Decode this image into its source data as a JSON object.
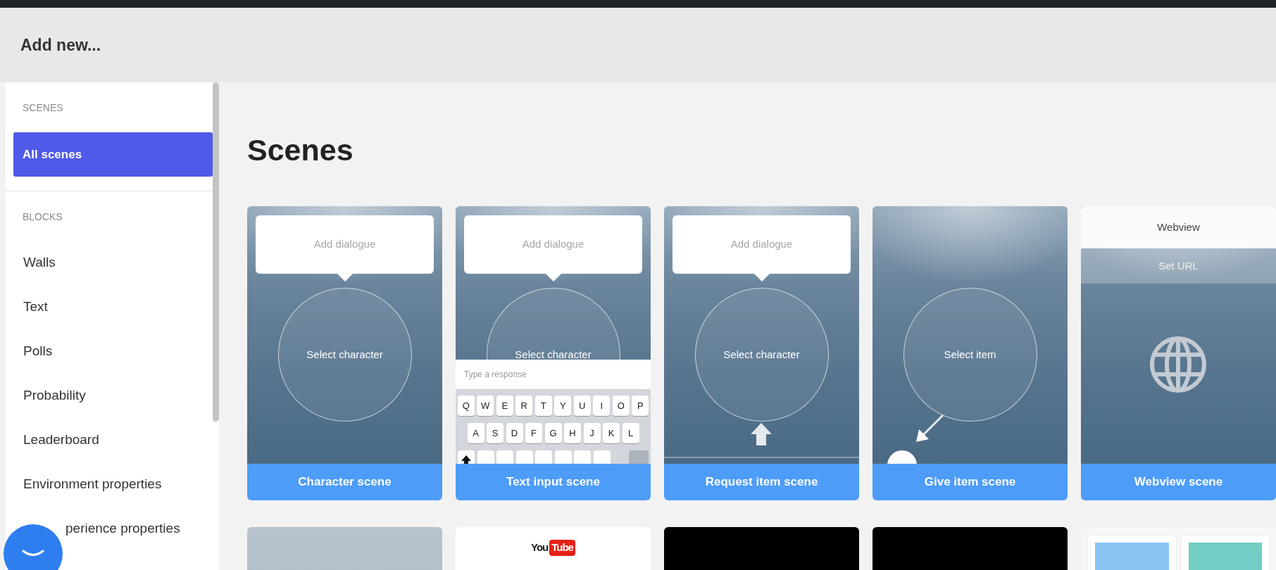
{
  "header": {
    "title": "Add new..."
  },
  "sidebar": {
    "sections": [
      {
        "heading": "SCENES",
        "items": [
          {
            "label": "All scenes",
            "selected": true
          }
        ]
      },
      {
        "heading": "BLOCKS",
        "items": [
          {
            "label": "Walls",
            "selected": false
          },
          {
            "label": "Text",
            "selected": false
          },
          {
            "label": "Polls",
            "selected": false
          },
          {
            "label": "Probability",
            "selected": false
          },
          {
            "label": "Leaderboard",
            "selected": false
          },
          {
            "label": "Environment properties",
            "selected": false
          },
          {
            "label": "perience properties",
            "selected": false,
            "partly_hidden": true
          }
        ]
      }
    ]
  },
  "main": {
    "heading": "Scenes",
    "cards": [
      {
        "kind": "character",
        "dialogue": "Add dialogue",
        "target": "Select character",
        "label": "Character scene"
      },
      {
        "kind": "text_input",
        "dialogue": "Add dialogue",
        "target": "Select character",
        "response_placeholder": "Type a response",
        "keys": [
          [
            "Q",
            "W",
            "E",
            "R",
            "T",
            "Y",
            "U",
            "I",
            "O",
            "P"
          ],
          [
            "A",
            "S",
            "D",
            "F",
            "G",
            "H",
            "J",
            "K",
            "L"
          ]
        ],
        "label": "Text input scene"
      },
      {
        "kind": "request_item",
        "dialogue": "Add dialogue",
        "target": "Select character",
        "label": "Request item scene"
      },
      {
        "kind": "give_item",
        "target": "Select item",
        "label": "Give item scene"
      },
      {
        "kind": "webview",
        "header": "Webview",
        "url_placeholder": "Set URL",
        "label": "Webview scene"
      }
    ],
    "more_cards": [
      {
        "kind": "scene"
      },
      {
        "kind": "youtube",
        "logo": {
          "left": "You",
          "right": "Tube"
        }
      },
      {
        "kind": "black"
      },
      {
        "kind": "black"
      },
      {
        "kind": "tiles"
      }
    ]
  }
}
